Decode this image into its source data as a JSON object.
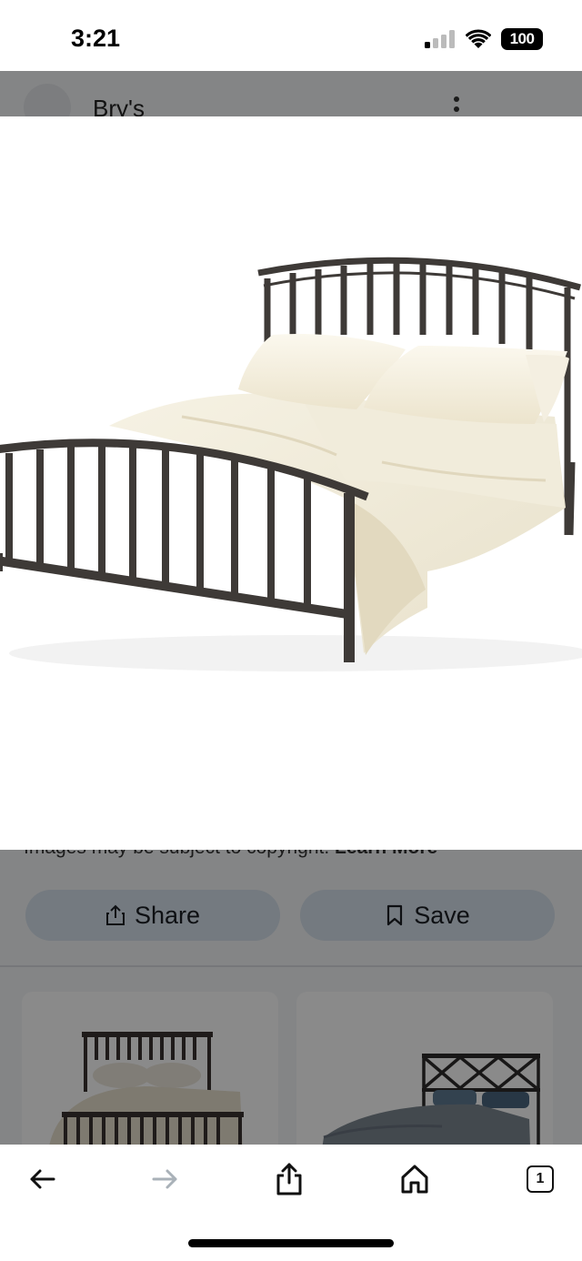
{
  "status_bar": {
    "time": "3:21",
    "battery": "100",
    "signal_icon": "cellular-signal-icon",
    "wifi_icon": "wifi-icon"
  },
  "site_header": {
    "name": "Bry's",
    "more_icon": "more-vert-icon"
  },
  "viewer": {
    "subject": "bed-frame-image"
  },
  "copyright": {
    "text": "Images may be subject to copyright.",
    "link": "Learn More"
  },
  "actions": {
    "share_label": "Share",
    "save_label": "Save"
  },
  "toolbar": {
    "back_icon": "back-arrow-icon",
    "forward_icon": "forward-arrow-icon",
    "share_icon": "share-icon",
    "home_icon": "home-icon",
    "tab_count": "1"
  },
  "colors": {
    "button_bg": "#d6e1ec",
    "bed_frame": "#3e3a37",
    "bedding": "#f1ecdb"
  }
}
